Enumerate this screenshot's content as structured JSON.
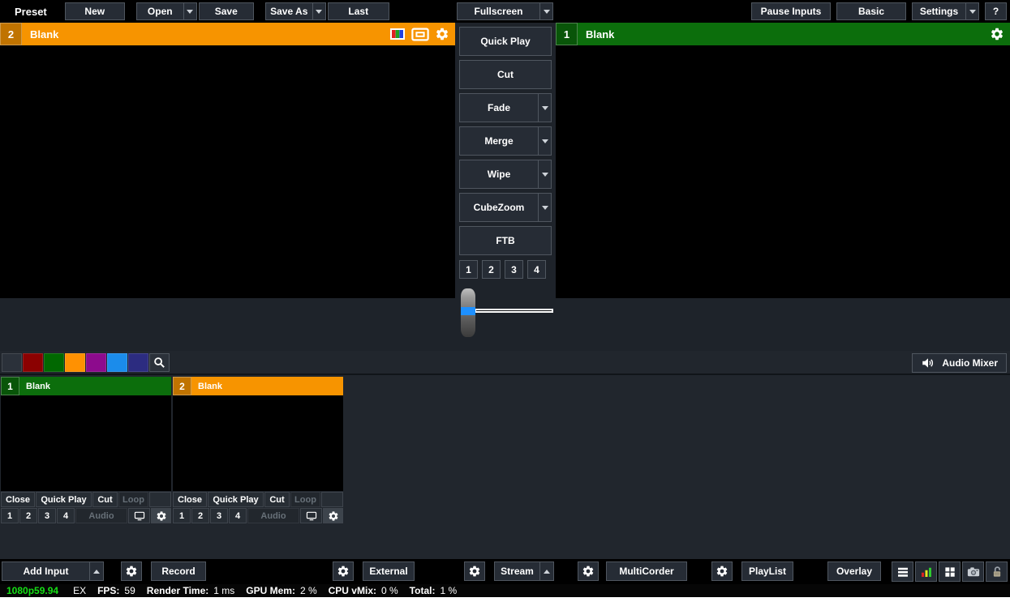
{
  "top_toolbar": {
    "preset_label": "Preset",
    "new": "New",
    "open": "Open",
    "save": "Save",
    "save_as": "Save As",
    "last": "Last",
    "fullscreen": "Fullscreen",
    "pause_inputs": "Pause Inputs",
    "basic": "Basic",
    "settings": "Settings",
    "help": "?"
  },
  "preview_window": {
    "number": "2",
    "title": "Blank"
  },
  "program_window": {
    "number": "1",
    "title": "Blank"
  },
  "transition_panel": {
    "buttons": [
      {
        "label": "Quick Play",
        "has_arrow": false
      },
      {
        "label": "Cut",
        "has_arrow": false
      },
      {
        "label": "Fade",
        "has_arrow": true
      },
      {
        "label": "Merge",
        "has_arrow": true
      },
      {
        "label": "Wipe",
        "has_arrow": true
      },
      {
        "label": "CubeZoom",
        "has_arrow": true
      },
      {
        "label": "FTB",
        "has_arrow": false
      }
    ],
    "overlay_numbers": [
      "1",
      "2",
      "3",
      "4"
    ]
  },
  "color_filter_bar": {
    "swatches": [
      {
        "name": "none",
        "color": "#2b313a"
      },
      {
        "name": "dark-red",
        "color": "#8b0101"
      },
      {
        "name": "dark-green",
        "color": "#016801"
      },
      {
        "name": "orange",
        "color": "#ff9102"
      },
      {
        "name": "purple",
        "color": "#8d0b8d"
      },
      {
        "name": "blue",
        "color": "#1b8ceb"
      },
      {
        "name": "navy",
        "color": "#2c2c80"
      }
    ],
    "audio_mixer_label": "Audio Mixer"
  },
  "inputs": [
    {
      "number": "1",
      "title": "Blank",
      "accent_color": "#0c6e0c",
      "close": "Close",
      "quick_play": "Quick Play",
      "cut": "Cut",
      "loop": "Loop",
      "overlay_numbers": [
        "1",
        "2",
        "3",
        "4"
      ],
      "audio": "Audio"
    },
    {
      "number": "2",
      "title": "Blank",
      "accent_color": "#f79400",
      "close": "Close",
      "quick_play": "Quick Play",
      "cut": "Cut",
      "loop": "Loop",
      "overlay_numbers": [
        "1",
        "2",
        "3",
        "4"
      ],
      "audio": "Audio"
    }
  ],
  "bottom_toolbar": {
    "add_input": "Add Input",
    "record": "Record",
    "external": "External",
    "stream": "Stream",
    "multicorder": "MultiCorder",
    "playlist": "PlayList",
    "overlay": "Overlay"
  },
  "status_bar": {
    "resolution": "1080p59.94",
    "ex": "EX",
    "fps_label": "FPS:",
    "fps_value": "59",
    "render_label": "Render Time:",
    "render_value": "1 ms",
    "gpu_label": "GPU Mem:",
    "gpu_value": "2 %",
    "cpu_label": "CPU vMix:",
    "cpu_value": "0 %",
    "total_label": "Total:",
    "total_value": "1 %"
  },
  "colors": {
    "preview_accent": "#f79400",
    "program_accent": "#0c6e0c",
    "tbar_highlight": "#1e90ff",
    "status_resolution_text": "#15e015",
    "chart_icon_bars": [
      "#dd2222",
      "#e6e622",
      "#2ecc2e"
    ]
  }
}
